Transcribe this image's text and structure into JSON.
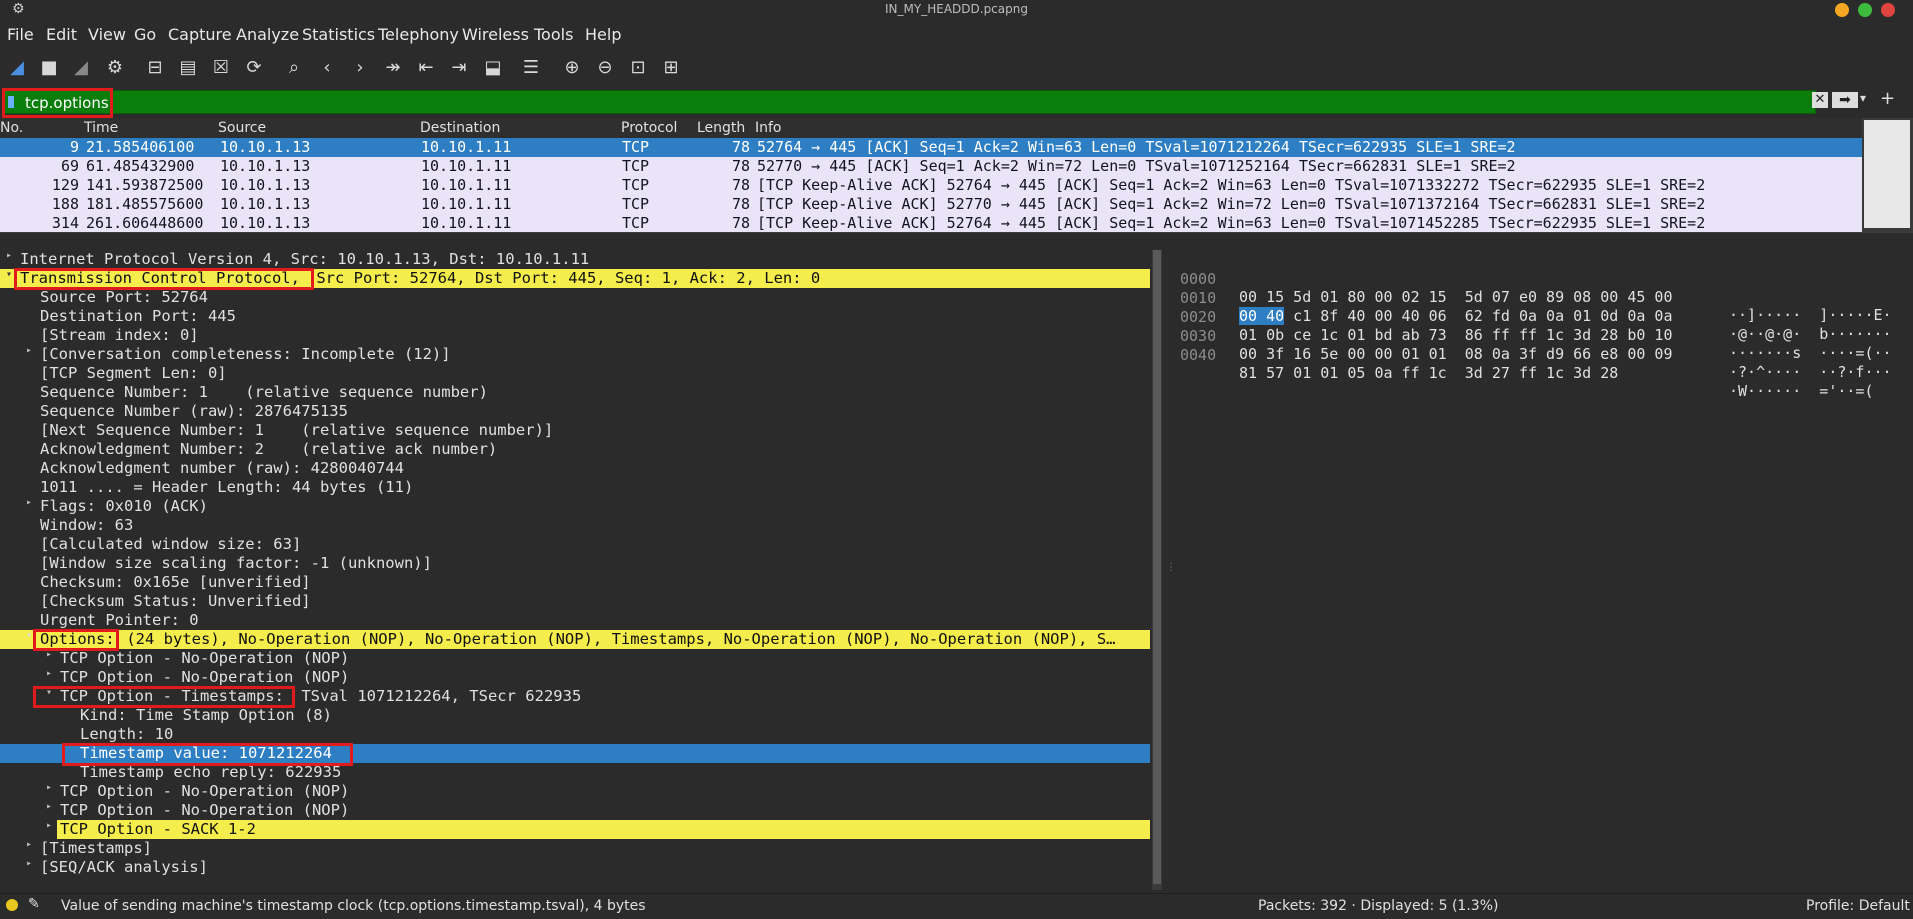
{
  "window": {
    "title": "IN_MY_HEADDD.pcapng"
  },
  "menu": [
    "File",
    "Edit",
    "View",
    "Go",
    "Capture",
    "Analyze",
    "Statistics",
    "Telephony",
    "Wireless",
    "Tools",
    "Help"
  ],
  "filter": {
    "value": "tcp.options"
  },
  "packet_list": {
    "columns": [
      "No.",
      "Time",
      "Source",
      "Destination",
      "Protocol",
      "Length",
      "Info"
    ],
    "rows": [
      {
        "no": "9",
        "time": "21.585406100",
        "src": "10.10.1.13",
        "dst": "10.10.1.11",
        "proto": "TCP",
        "len": "78",
        "info": "52764 → 445 [ACK] Seq=1 Ack=2 Win=63 Len=0 TSval=1071212264 TSecr=622935 SLE=1 SRE=2"
      },
      {
        "no": "69",
        "time": "61.485432900",
        "src": "10.10.1.13",
        "dst": "10.10.1.11",
        "proto": "TCP",
        "len": "78",
        "info": "52770 → 445 [ACK] Seq=1 Ack=2 Win=72 Len=0 TSval=1071252164 TSecr=662831 SLE=1 SRE=2"
      },
      {
        "no": "129",
        "time": "141.593872500",
        "src": "10.10.1.13",
        "dst": "10.10.1.11",
        "proto": "TCP",
        "len": "78",
        "info": "[TCP Keep-Alive ACK] 52764 → 445 [ACK] Seq=1 Ack=2 Win=63 Len=0 TSval=1071332272 TSecr=622935 SLE=1 SRE=2"
      },
      {
        "no": "188",
        "time": "181.485575600",
        "src": "10.10.1.13",
        "dst": "10.10.1.11",
        "proto": "TCP",
        "len": "78",
        "info": "[TCP Keep-Alive ACK] 52770 → 445 [ACK] Seq=1 Ack=2 Win=72 Len=0 TSval=1071372164 TSecr=662831 SLE=1 SRE=2"
      },
      {
        "no": "314",
        "time": "261.606448600",
        "src": "10.10.1.13",
        "dst": "10.10.1.11",
        "proto": "TCP",
        "len": "78",
        "info": "[TCP Keep-Alive ACK] 52764 → 445 [ACK] Seq=1 Ack=2 Win=63 Len=0 TSval=1071452285 TSecr=622935 SLE=1 SRE=2"
      }
    ]
  },
  "details": {
    "ip": "Internet Protocol Version 4, Src: 10.10.1.13, Dst: 10.10.1.11",
    "tcp_a": "Transmission Control Protocol,",
    "tcp_b": " Src Port: 52764, Dst Port: 445, Seq: 1, Ack: 2, Len: 0",
    "src_port": "Source Port: 52764",
    "dst_port": "Destination Port: 445",
    "stream": "[Stream index: 0]",
    "conv": "[Conversation completeness: Incomplete (12)]",
    "seglen": "[TCP Segment Len: 0]",
    "seq": "Sequence Number: 1    (relative sequence number)",
    "seq_raw": "Sequence Number (raw): 2876475135",
    "next_seq": "[Next Sequence Number: 1    (relative sequence number)]",
    "ack": "Acknowledgment Number: 2    (relative ack number)",
    "ack_raw": "Acknowledgment number (raw): 4280040744",
    "hdrlen": "1011 .... = Header Length: 44 bytes (11)",
    "flags": "Flags: 0x010 (ACK)",
    "window": "Window: 63",
    "calc_win": "[Calculated window size: 63]",
    "win_scale": "[Window size scaling factor: -1 (unknown)]",
    "checksum": "Checksum: 0x165e [unverified]",
    "checksum_status": "[Checksum Status: Unverified]",
    "urgent": "Urgent Pointer: 0",
    "options_a": "Options:",
    "options_b": " (24 bytes), No-Operation (NOP), No-Operation (NOP), Timestamps, No-Operation (NOP), No-Operation (NOP), S…",
    "nop1": "TCP Option - No-Operation (NOP)",
    "nop2": "TCP Option - No-Operation (NOP)",
    "ts_a": "TCP Option - Timestamps:",
    "ts_b": " TSval 1071212264, TSecr 622935",
    "kind": "Kind: Time Stamp Option (8)",
    "length": "Length: 10",
    "tsval": "Timestamp value: 1071212264",
    "tsecr": "Timestamp echo reply: 622935",
    "nop3": "TCP Option - No-Operation (NOP)",
    "nop4": "TCP Option - No-Operation (NOP)",
    "sack": "TCP Option - SACK 1-2",
    "timestamps": "[Timestamps]",
    "seqack": "[SEQ/ACK analysis]"
  },
  "hex": [
    {
      "off": "0000",
      "bytes_a": "",
      "sel": "",
      "bytes_b": "00 15 5d 01 80 00 02 15  5d 07 e0 89 08 00 45 00",
      "ascii": "··]·····  ]·····E·"
    },
    {
      "off": "0010",
      "bytes_a": "",
      "sel": "00 40",
      "bytes_b": " c1 8f 40 00 40 06  62 fd 0a 0a 01 0d 0a 0a",
      "ascii": "·@··@·@·  b·······"
    },
    {
      "off": "0020",
      "bytes_a": "",
      "sel": "",
      "bytes_b": "01 0b ce 1c 01 bd ab 73  86 ff ff 1c 3d 28 b0 10",
      "ascii": "·······s  ····=(··"
    },
    {
      "off": "0030",
      "bytes_a": "",
      "sel": "",
      "bytes_b": "00 3f 16 5e 00 00 01 01  08 0a 3f d9 66 e8 00 09",
      "ascii": "·?·^····  ··?·f···"
    },
    {
      "off": "0040",
      "bytes_a": "",
      "sel": "",
      "bytes_b": "81 57 01 01 05 0a ff 1c  3d 27 ff 1c 3d 28",
      "ascii": "·W······  ='··=("
    }
  ],
  "status": {
    "message": "Value of sending machine's timestamp clock (tcp.options.timestamp.tsval), 4 bytes",
    "packets": "Packets: 392 · Displayed: 5 (1.3%)",
    "profile": "Profile: Default"
  },
  "colors": {
    "highlight": "#f4ed4c",
    "selection": "#2e7ec3",
    "filter_ok": "#0b7d0b",
    "annotation": "#e11b1b"
  }
}
